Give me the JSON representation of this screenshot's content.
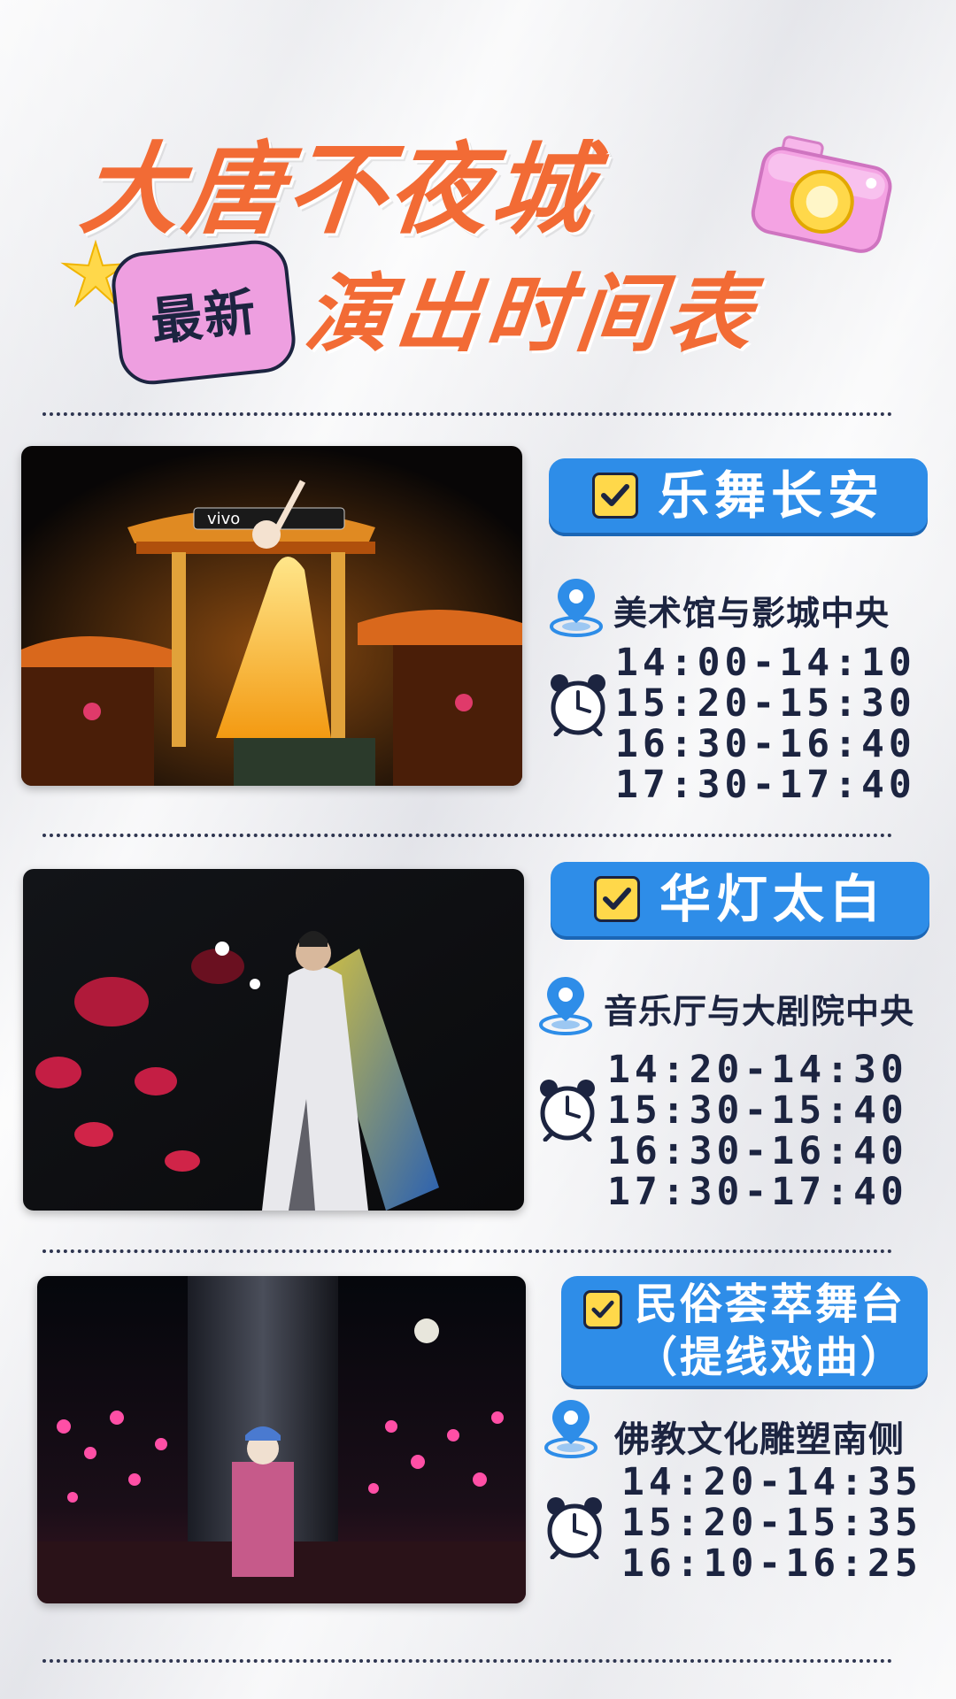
{
  "header": {
    "title": "大唐不夜城",
    "badge": "最新",
    "subtitle": "演出时间表"
  },
  "colors": {
    "title_orange": "#f26b35",
    "badge_pink": "#ee9fe0",
    "pill_blue": "#2e8de8",
    "check_yellow": "#ffd84a",
    "text_navy": "#1c2440"
  },
  "shows": [
    {
      "title": "乐舞长安",
      "location": "美术馆与影城中央",
      "times": [
        "14:00-14:10",
        "15:20-15:30",
        "16:30-16:40",
        "17:30-17:40"
      ]
    },
    {
      "title": "华灯太白",
      "location": "音乐厅与大剧院中央",
      "times": [
        "14:20-14:30",
        "15:30-15:40",
        "16:30-16:40",
        "17:30-17:40"
      ]
    },
    {
      "title_line1": "民俗荟萃舞台",
      "title_line2": "（提线戏曲）",
      "location": "佛教文化雕塑南侧",
      "times": [
        "14:20-14:35",
        "15:20-15:35",
        "16:10-16:25"
      ]
    }
  ],
  "icons": {
    "check": "check-icon",
    "location": "location-pin-icon",
    "clock": "alarm-clock-icon",
    "camera": "camera-icon",
    "star": "sparkle-star-icon"
  }
}
